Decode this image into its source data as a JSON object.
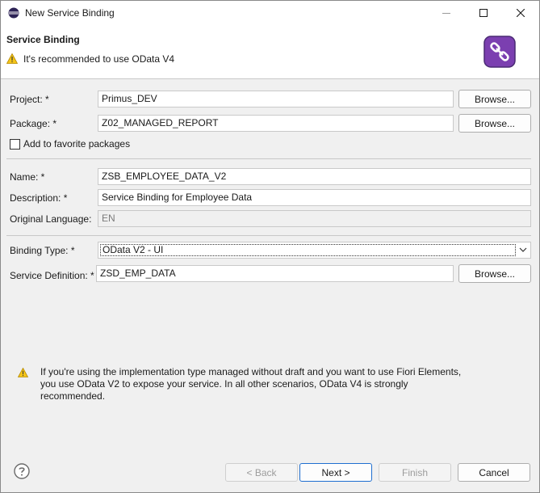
{
  "window": {
    "title": "New Service Binding",
    "minimize_icon": "minimize-icon",
    "maximize_icon": "maximize-icon",
    "close_icon": "close-icon"
  },
  "header": {
    "title": "Service Binding",
    "message": "It's recommended to use OData V4",
    "message_icon": "warning-icon",
    "banner_icon": "service-binding-wizard-icon"
  },
  "form": {
    "project": {
      "label": "Project: *",
      "value": "Primus_DEV",
      "browse": "Browse..."
    },
    "package": {
      "label": "Package: *",
      "value": "Z02_MANAGED_REPORT",
      "browse": "Browse..."
    },
    "favorite": {
      "label": "Add to favorite packages",
      "checked": false
    },
    "name": {
      "label": "Name: *",
      "value": "ZSB_EMPLOYEE_DATA_V2"
    },
    "description": {
      "label": "Description: *",
      "value": "Service Binding for Employee Data"
    },
    "original_language": {
      "label": "Original Language:",
      "value": "EN"
    },
    "binding_type": {
      "label": "Binding Type: *",
      "value": "OData V2 - UI"
    },
    "service_definition": {
      "label": "Service Definition: *",
      "value": "ZSD_EMP_DATA",
      "browse": "Browse..."
    }
  },
  "info": {
    "icon": "warning-icon",
    "text": "If you're using the implementation type managed without draft and you want to use Fiori Elements, you use OData V2 to expose your service. In all other scenarios, OData V4 is strongly recommended."
  },
  "footer": {
    "help_icon": "help-icon",
    "back": "< Back",
    "next": "Next >",
    "finish": "Finish",
    "cancel": "Cancel"
  },
  "colors": {
    "banner_purple": "#7b3fb0",
    "warning_yellow": "#f5c518",
    "default_button_border": "#1f6fd0"
  }
}
